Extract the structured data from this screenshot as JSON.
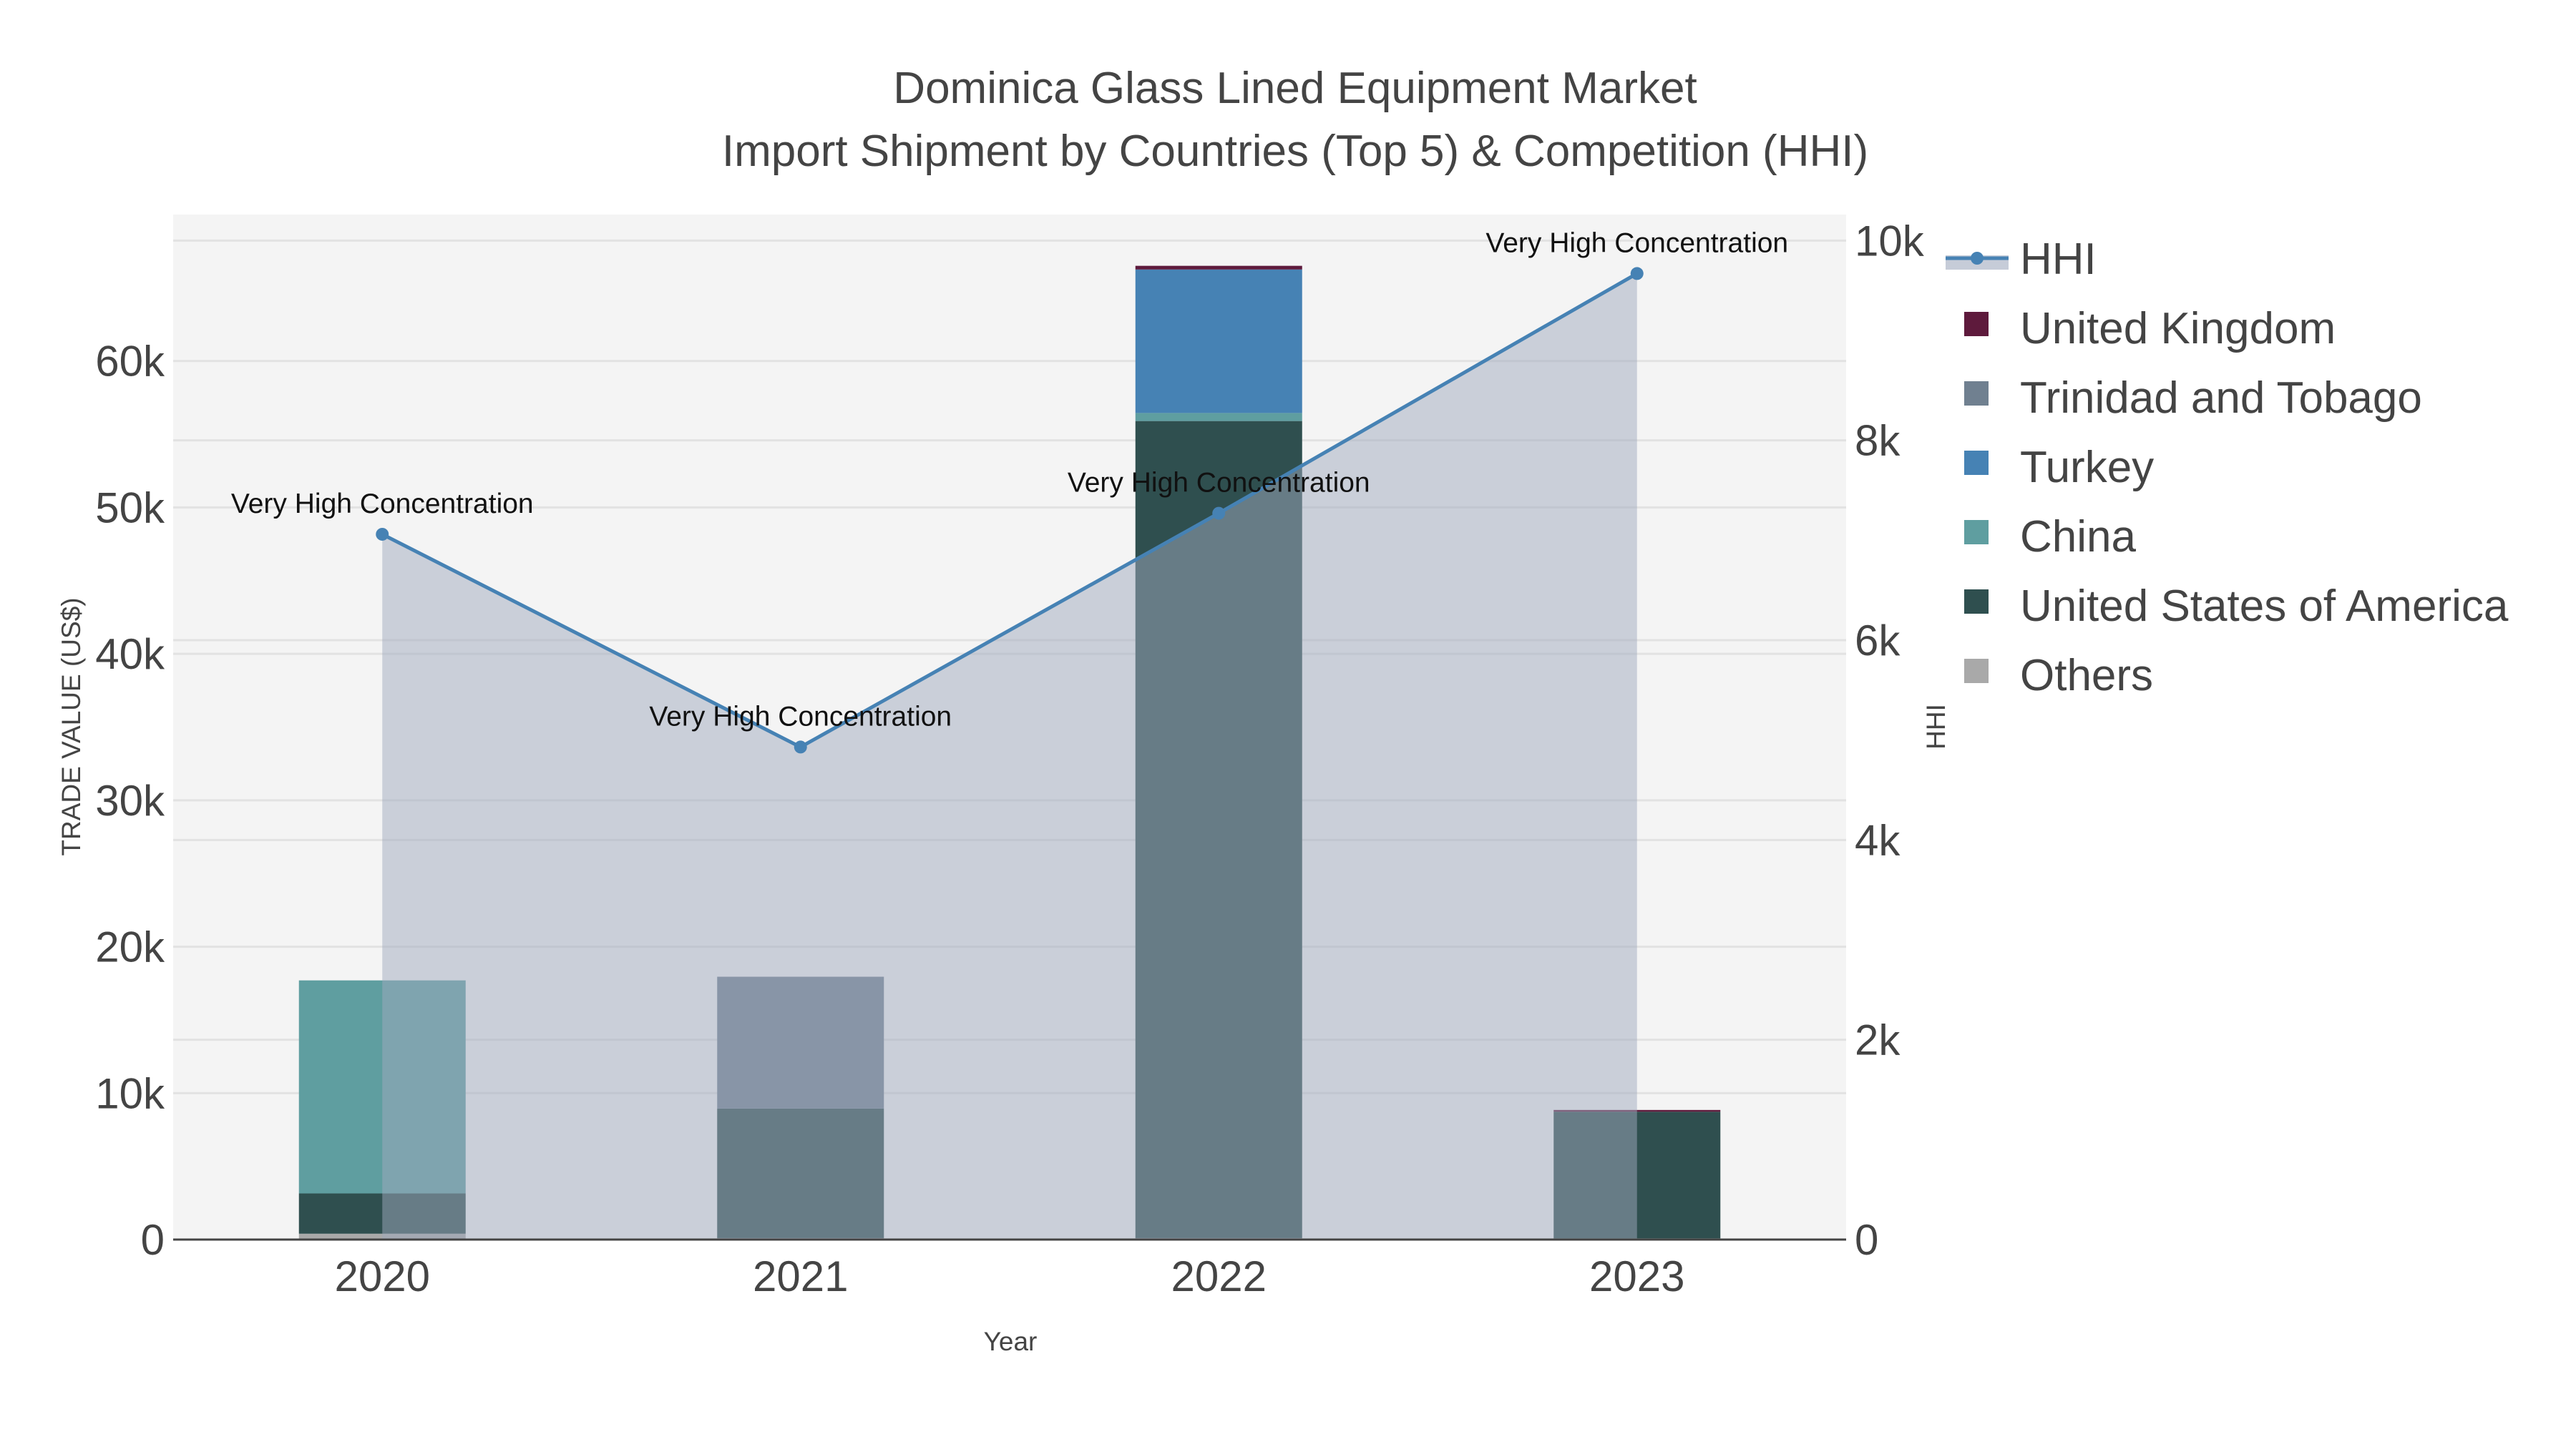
{
  "chart_data": {
    "type": "bar",
    "title": "Dominica Glass Lined Equipment Market",
    "subtitle": "Import Shipment by Countries (Top 5) & Competition (HHI)",
    "xlabel": "Year",
    "ylabel": "TRADE VALUE (US$)",
    "y2label": "HHI",
    "categories": [
      "2020",
      "2021",
      "2022",
      "2023"
    ],
    "ylim": [
      0,
      70000
    ],
    "y2lim": [
      0,
      10260
    ],
    "yticks": [
      {
        "v": 0,
        "label": "0"
      },
      {
        "v": 10000,
        "label": "10k"
      },
      {
        "v": 20000,
        "label": "20k"
      },
      {
        "v": 30000,
        "label": "30k"
      },
      {
        "v": 40000,
        "label": "40k"
      },
      {
        "v": 50000,
        "label": "50k"
      },
      {
        "v": 60000,
        "label": "60k"
      }
    ],
    "y2ticks": [
      {
        "v": 0,
        "label": "0"
      },
      {
        "v": 2000,
        "label": "2k"
      },
      {
        "v": 4000,
        "label": "4k"
      },
      {
        "v": 6000,
        "label": "6k"
      },
      {
        "v": 8000,
        "label": "8k"
      },
      {
        "v": 10000,
        "label": "10k"
      }
    ],
    "stack_order": [
      "Others",
      "United States of America",
      "China",
      "Turkey",
      "Trinidad and Tobago",
      "United Kingdom"
    ],
    "series": [
      {
        "name": "United Kingdom",
        "color": "#5e1a3c",
        "values": [
          0,
          0,
          250,
          120
        ]
      },
      {
        "name": "Trinidad and Tobago",
        "color": "#708090",
        "values": [
          0,
          9000,
          0,
          0
        ]
      },
      {
        "name": "Turkey",
        "color": "#4682b4",
        "values": [
          0,
          0,
          9800,
          0
        ]
      },
      {
        "name": "China",
        "color": "#5f9ea0",
        "values": [
          14550,
          0,
          550,
          0
        ]
      },
      {
        "name": "United States of America",
        "color": "#2f4f4f",
        "values": [
          2750,
          8850,
          55800,
          8650
        ]
      },
      {
        "name": "Others",
        "color": "#a9a9a9",
        "values": [
          400,
          100,
          100,
          80
        ]
      }
    ],
    "hhi": {
      "name": "HHI",
      "color": "#4682b4",
      "values": [
        7060,
        4930,
        7270,
        9670
      ],
      "annotations": [
        "Very High Concentration",
        "Very High Concentration",
        "Very High Concentration",
        "Very High Concentration"
      ]
    },
    "legend": [
      "HHI",
      "United Kingdom",
      "Trinidad and Tobago",
      "Turkey",
      "China",
      "United States of America",
      "Others"
    ],
    "legend_placement": "right",
    "grid": true
  }
}
